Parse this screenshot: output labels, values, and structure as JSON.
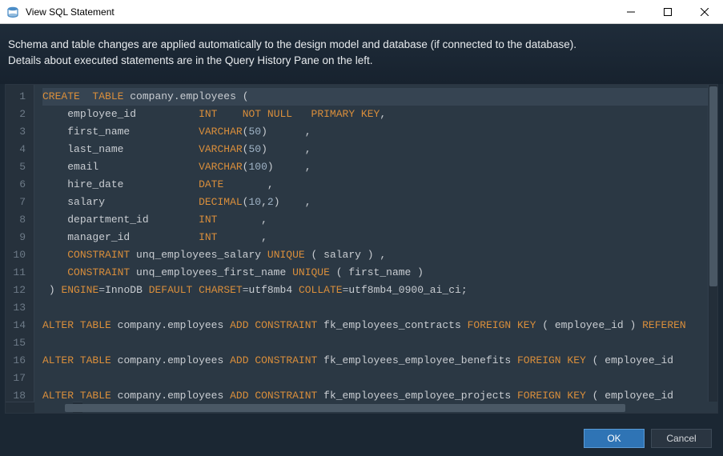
{
  "window": {
    "title": "View SQL Statement"
  },
  "description": {
    "line1": "Schema and table changes are applied automatically to the design model and database (if connected to the database).",
    "line2": "Details about executed statements are in the Query History Pane on the left."
  },
  "buttons": {
    "ok": "OK",
    "cancel": "Cancel"
  },
  "code": {
    "lines": [
      {
        "n": 1,
        "hl": true,
        "tokens": [
          [
            "kw",
            "CREATE"
          ],
          [
            "sp",
            "  "
          ],
          [
            "kw",
            "TABLE"
          ],
          [
            "sp",
            " "
          ],
          [
            "id",
            "company.employees"
          ],
          [
            "sp",
            " "
          ],
          [
            "pn",
            "("
          ]
        ]
      },
      {
        "n": 2,
        "tokens": [
          [
            "sp",
            "    "
          ],
          [
            "id",
            "employee_id"
          ],
          [
            "sp",
            "          "
          ],
          [
            "ty",
            "INT"
          ],
          [
            "sp",
            "    "
          ],
          [
            "kw",
            "NOT NULL"
          ],
          [
            "sp",
            "   "
          ],
          [
            "kw",
            "PRIMARY KEY"
          ],
          [
            "pn",
            ","
          ]
        ]
      },
      {
        "n": 3,
        "tokens": [
          [
            "sp",
            "    "
          ],
          [
            "id",
            "first_name"
          ],
          [
            "sp",
            "           "
          ],
          [
            "ty",
            "VARCHAR"
          ],
          [
            "pn",
            "("
          ],
          [
            "num",
            "50"
          ],
          [
            "pn",
            ")"
          ],
          [
            "sp",
            "      "
          ],
          [
            "pn",
            ","
          ]
        ]
      },
      {
        "n": 4,
        "tokens": [
          [
            "sp",
            "    "
          ],
          [
            "id",
            "last_name"
          ],
          [
            "sp",
            "            "
          ],
          [
            "ty",
            "VARCHAR"
          ],
          [
            "pn",
            "("
          ],
          [
            "num",
            "50"
          ],
          [
            "pn",
            ")"
          ],
          [
            "sp",
            "      "
          ],
          [
            "pn",
            ","
          ]
        ]
      },
      {
        "n": 5,
        "tokens": [
          [
            "sp",
            "    "
          ],
          [
            "id",
            "email"
          ],
          [
            "sp",
            "                "
          ],
          [
            "ty",
            "VARCHAR"
          ],
          [
            "pn",
            "("
          ],
          [
            "num",
            "100"
          ],
          [
            "pn",
            ")"
          ],
          [
            "sp",
            "     "
          ],
          [
            "pn",
            ","
          ]
        ]
      },
      {
        "n": 6,
        "tokens": [
          [
            "sp",
            "    "
          ],
          [
            "id",
            "hire_date"
          ],
          [
            "sp",
            "            "
          ],
          [
            "ty",
            "DATE"
          ],
          [
            "sp",
            "       "
          ],
          [
            "pn",
            ","
          ]
        ]
      },
      {
        "n": 7,
        "tokens": [
          [
            "sp",
            "    "
          ],
          [
            "id",
            "salary"
          ],
          [
            "sp",
            "               "
          ],
          [
            "ty",
            "DECIMAL"
          ],
          [
            "pn",
            "("
          ],
          [
            "num",
            "10"
          ],
          [
            "pn",
            ","
          ],
          [
            "num",
            "2"
          ],
          [
            "pn",
            ")"
          ],
          [
            "sp",
            "    "
          ],
          [
            "pn",
            ","
          ]
        ]
      },
      {
        "n": 8,
        "tokens": [
          [
            "sp",
            "    "
          ],
          [
            "id",
            "department_id"
          ],
          [
            "sp",
            "        "
          ],
          [
            "ty",
            "INT"
          ],
          [
            "sp",
            "       "
          ],
          [
            "pn",
            ","
          ]
        ]
      },
      {
        "n": 9,
        "tokens": [
          [
            "sp",
            "    "
          ],
          [
            "id",
            "manager_id"
          ],
          [
            "sp",
            "           "
          ],
          [
            "ty",
            "INT"
          ],
          [
            "sp",
            "       "
          ],
          [
            "pn",
            ","
          ]
        ]
      },
      {
        "n": 10,
        "tokens": [
          [
            "sp",
            "    "
          ],
          [
            "kw",
            "CONSTRAINT"
          ],
          [
            "sp",
            " "
          ],
          [
            "id",
            "unq_employees_salary"
          ],
          [
            "sp",
            " "
          ],
          [
            "kw",
            "UNIQUE"
          ],
          [
            "sp",
            " "
          ],
          [
            "pn",
            "("
          ],
          [
            "sp",
            " "
          ],
          [
            "id",
            "salary"
          ],
          [
            "sp",
            " "
          ],
          [
            "pn",
            ")"
          ],
          [
            "sp",
            " "
          ],
          [
            "pn",
            ","
          ]
        ]
      },
      {
        "n": 11,
        "tokens": [
          [
            "sp",
            "    "
          ],
          [
            "kw",
            "CONSTRAINT"
          ],
          [
            "sp",
            " "
          ],
          [
            "id",
            "unq_employees_first_name"
          ],
          [
            "sp",
            " "
          ],
          [
            "kw",
            "UNIQUE"
          ],
          [
            "sp",
            " "
          ],
          [
            "pn",
            "("
          ],
          [
            "sp",
            " "
          ],
          [
            "id",
            "first_name"
          ],
          [
            "sp",
            " "
          ],
          [
            "pn",
            ")"
          ]
        ]
      },
      {
        "n": 12,
        "tokens": [
          [
            "sp",
            " "
          ],
          [
            "pn",
            ")"
          ],
          [
            "sp",
            " "
          ],
          [
            "kw",
            "ENGINE"
          ],
          [
            "op",
            "="
          ],
          [
            "id",
            "InnoDB"
          ],
          [
            "sp",
            " "
          ],
          [
            "kw",
            "DEFAULT"
          ],
          [
            "sp",
            " "
          ],
          [
            "kw",
            "CHARSET"
          ],
          [
            "op",
            "="
          ],
          [
            "id",
            "utf8mb4"
          ],
          [
            "sp",
            " "
          ],
          [
            "kw",
            "COLLATE"
          ],
          [
            "op",
            "="
          ],
          [
            "id",
            "utf8mb4_0900_ai_ci"
          ],
          [
            "pn",
            ";"
          ]
        ]
      },
      {
        "n": 13,
        "tokens": []
      },
      {
        "n": 14,
        "tokens": [
          [
            "kw",
            "ALTER"
          ],
          [
            "sp",
            " "
          ],
          [
            "kw",
            "TABLE"
          ],
          [
            "sp",
            " "
          ],
          [
            "id",
            "company.employees"
          ],
          [
            "sp",
            " "
          ],
          [
            "kw",
            "ADD"
          ],
          [
            "sp",
            " "
          ],
          [
            "kw",
            "CONSTRAINT"
          ],
          [
            "sp",
            " "
          ],
          [
            "id",
            "fk_employees_contracts"
          ],
          [
            "sp",
            " "
          ],
          [
            "kw",
            "FOREIGN KEY"
          ],
          [
            "sp",
            " "
          ],
          [
            "pn",
            "("
          ],
          [
            "sp",
            " "
          ],
          [
            "id",
            "employee_id"
          ],
          [
            "sp",
            " "
          ],
          [
            "pn",
            ")"
          ],
          [
            "sp",
            " "
          ],
          [
            "kw",
            "REFEREN"
          ]
        ]
      },
      {
        "n": 15,
        "tokens": []
      },
      {
        "n": 16,
        "tokens": [
          [
            "kw",
            "ALTER"
          ],
          [
            "sp",
            " "
          ],
          [
            "kw",
            "TABLE"
          ],
          [
            "sp",
            " "
          ],
          [
            "id",
            "company.employees"
          ],
          [
            "sp",
            " "
          ],
          [
            "kw",
            "ADD"
          ],
          [
            "sp",
            " "
          ],
          [
            "kw",
            "CONSTRAINT"
          ],
          [
            "sp",
            " "
          ],
          [
            "id",
            "fk_employees_employee_benefits"
          ],
          [
            "sp",
            " "
          ],
          [
            "kw",
            "FOREIGN KEY"
          ],
          [
            "sp",
            " "
          ],
          [
            "pn",
            "("
          ],
          [
            "sp",
            " "
          ],
          [
            "id",
            "employee_id"
          ],
          [
            "sp",
            " "
          ]
        ]
      },
      {
        "n": 17,
        "tokens": []
      },
      {
        "n": 18,
        "tokens": [
          [
            "kw",
            "ALTER"
          ],
          [
            "sp",
            " "
          ],
          [
            "kw",
            "TABLE"
          ],
          [
            "sp",
            " "
          ],
          [
            "id",
            "company.employees"
          ],
          [
            "sp",
            " "
          ],
          [
            "kw",
            "ADD"
          ],
          [
            "sp",
            " "
          ],
          [
            "kw",
            "CONSTRAINT"
          ],
          [
            "sp",
            " "
          ],
          [
            "id",
            "fk_employees_employee_projects"
          ],
          [
            "sp",
            " "
          ],
          [
            "kw",
            "FOREIGN KEY"
          ],
          [
            "sp",
            " "
          ],
          [
            "pn",
            "("
          ],
          [
            "sp",
            " "
          ],
          [
            "id",
            "employee_id"
          ],
          [
            "sp",
            " "
          ]
        ]
      }
    ]
  }
}
